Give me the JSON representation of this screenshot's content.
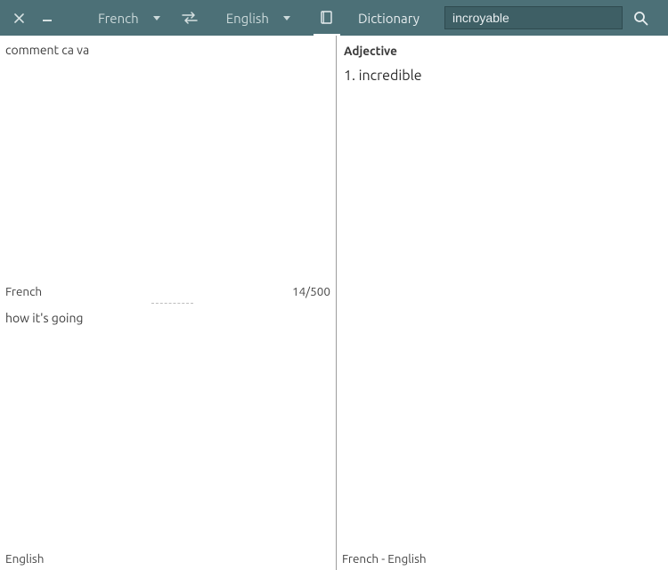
{
  "toolbar": {
    "source_lang": "French",
    "target_lang": "English",
    "dictionary_tab": "Dictionary",
    "search_value": "incroyable"
  },
  "left": {
    "input_text": "comment ca va",
    "input_lang": "French",
    "char_count": "14/500",
    "output_text": "how it's going",
    "output_lang": "English"
  },
  "right": {
    "part_of_speech": "Adjective",
    "definition_line": "1. incredible",
    "pair_label": "French - English"
  }
}
